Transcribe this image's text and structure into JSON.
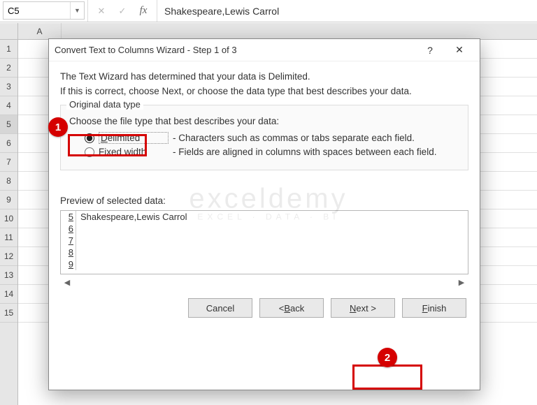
{
  "formula_bar": {
    "namebox_value": "C5",
    "formula_value": "Shakespeare,Lewis Carrol"
  },
  "grid": {
    "col_headers": [
      "A"
    ],
    "row_headers": [
      "1",
      "2",
      "3",
      "4",
      "5",
      "6",
      "7",
      "8",
      "9",
      "10",
      "11",
      "12",
      "13",
      "14",
      "15"
    ]
  },
  "dialog": {
    "title": "Convert Text to Columns Wizard - Step 1 of 3",
    "help_symbol": "?",
    "close_symbol": "✕",
    "intro_line1": "The Text Wizard has determined that your data is Delimited.",
    "intro_line2": "If this is correct, choose Next, or choose the data type that best describes your data.",
    "fieldset_legend": "Original data type",
    "fieldset_prompt": "Choose the file type that best describes your data:",
    "radio_options": [
      {
        "label_html": "<u>D</u>elimited",
        "description": "- Characters such as commas or tabs separate each field.",
        "selected": true
      },
      {
        "label_html": "Fixed <u>w</u>idth",
        "description": "- Fields are aligned in columns with spaces between each field.",
        "selected": false
      }
    ],
    "preview_label": "Preview of selected data:",
    "preview_rows": [
      {
        "n": "5",
        "v": "Shakespeare,Lewis Carrol"
      },
      {
        "n": "6",
        "v": ""
      },
      {
        "n": "7",
        "v": ""
      },
      {
        "n": "8",
        "v": ""
      },
      {
        "n": "9",
        "v": ""
      }
    ],
    "buttons": {
      "cancel": "Cancel",
      "back": "< Back",
      "next": "Next >",
      "finish": "Finish"
    }
  },
  "callouts": {
    "badge1": "1",
    "badge2": "2"
  },
  "watermark": {
    "line1": "exceldemy",
    "line2": "EXCEL · DATA · BI"
  }
}
